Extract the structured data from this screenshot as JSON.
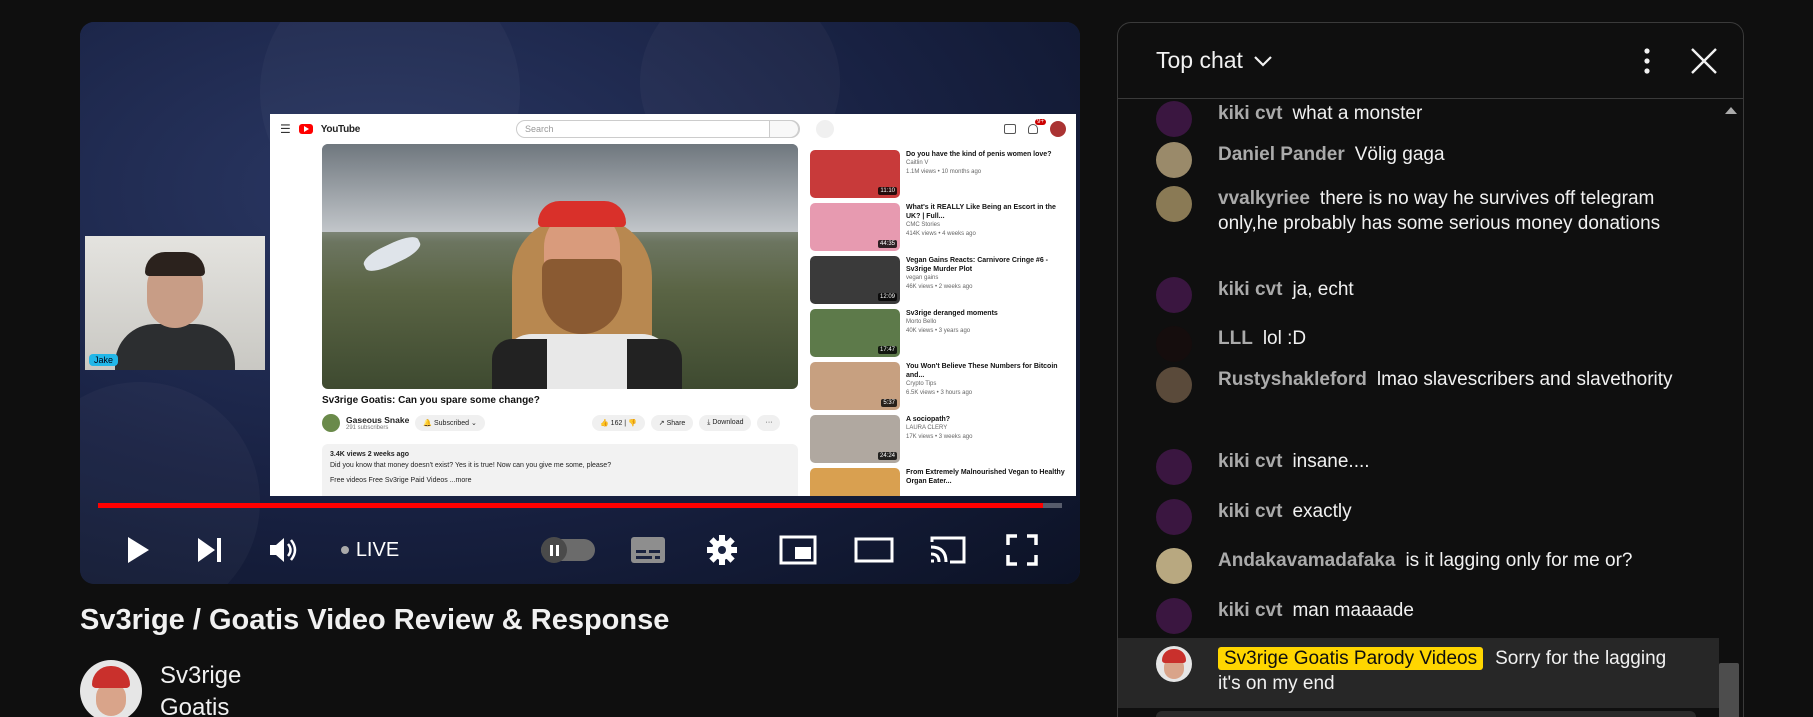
{
  "video": {
    "title": "Sv3rige / Goatis Video Review & Response",
    "channel_name": "Sv3rige Goatis",
    "live_label": "LIVE",
    "progress_fraction": 0.98
  },
  "stream": {
    "webcam_tag": "Jake",
    "inner_page": {
      "brand": "YouTube",
      "search_placeholder": "Search",
      "notif_count": "9+",
      "video_title": "Sv3rige Goatis: Can you spare some change?",
      "channel": "Gaseous Snake",
      "subscribers": "291 subscribers",
      "subscribed_label": "Subscribed",
      "likes": "162",
      "share_label": "Share",
      "download_label": "Download",
      "desc_meta": "3.4K views  2 weeks ago",
      "desc_text": "Did you know that money doesn't exist? Yes it is true! Now can you give me some, please?",
      "desc_tags": "Free videos   Free Sv3rige Paid Videos   ...more",
      "recommendations": [
        {
          "title": "Do you have the kind of penis women love?",
          "channel": "Caitlin V",
          "meta": "1.1M views • 10 months ago",
          "duration": "11:10",
          "color": "#c83a3a"
        },
        {
          "title": "What's it REALLY Like Being an Escort in the UK? | Full...",
          "channel": "CMC Stories",
          "meta": "414K views • 4 weeks ago",
          "duration": "44:35",
          "color": "#e79ab0"
        },
        {
          "title": "Vegan Gains Reacts: Carnivore Cringe #6 - Sv3rige Murder Plot",
          "channel": "vegan gains",
          "meta": "46K views • 2 weeks ago",
          "duration": "12:09",
          "color": "#3a3a3a"
        },
        {
          "title": "Sv3rige deranged moments",
          "channel": "Morto Bello",
          "meta": "40K views • 3 years ago",
          "duration": "17:47",
          "color": "#5d7a4a"
        },
        {
          "title": "You Won't Believe These Numbers for Bitcoin and...",
          "channel": "Crypto Tips",
          "meta": "6.5K views • 3 hours ago",
          "duration": "5:37",
          "color": "#c7a080"
        },
        {
          "title": "A sociopath?",
          "channel": "LAURA CLERY",
          "meta": "17K views • 3 weeks ago",
          "duration": "24:24",
          "color": "#b0a8a0"
        },
        {
          "title": "From Extremely Malnourished Vegan to Healthy Organ Eater...",
          "channel": "",
          "meta": "",
          "duration": "",
          "color": "#d9a050"
        }
      ]
    }
  },
  "chat": {
    "mode_label": "Top chat",
    "messages": [
      {
        "author": "kiki cvt",
        "text": "what a monster",
        "avatar_color": "#3a1640"
      },
      {
        "author": "Daniel Pander",
        "text": "Völig gaga",
        "avatar_color": "#9a8a6a"
      },
      {
        "author": "vvalkyriee",
        "text": "there is no way he survives off telegram only,he probably has some serious money donations",
        "avatar_color": "#8a7a55"
      },
      {
        "author": "kiki cvt",
        "text": "ja, echt",
        "avatar_color": "#3a1640"
      },
      {
        "author": "LLL",
        "text": "lol :D",
        "avatar_color": "#150d0d"
      },
      {
        "author": "Rustyshakleford",
        "text": "lmao slavescribers and slavethority",
        "avatar_color": "#5a4a3a"
      },
      {
        "author": "kiki cvt",
        "text": "insane....",
        "avatar_color": "#3a1640"
      },
      {
        "author": "kiki cvt",
        "text": "exactly",
        "avatar_color": "#3a1640"
      },
      {
        "author": "Andakavamadafaka",
        "text": "is it lagging only for me or?",
        "avatar_color": "#b8a880"
      },
      {
        "author": "kiki cvt",
        "text": "man maaaade",
        "avatar_color": "#3a1640"
      },
      {
        "author": "Sv3rige Goatis Parody Videos",
        "text": "Sorry for the lagging it's on my end",
        "avatar_color": "#e6e6e6",
        "owner": true
      }
    ]
  },
  "colors": {
    "progress": "#ff0000",
    "owner_badge": "#ffd600",
    "author": "#aaaaaa"
  }
}
